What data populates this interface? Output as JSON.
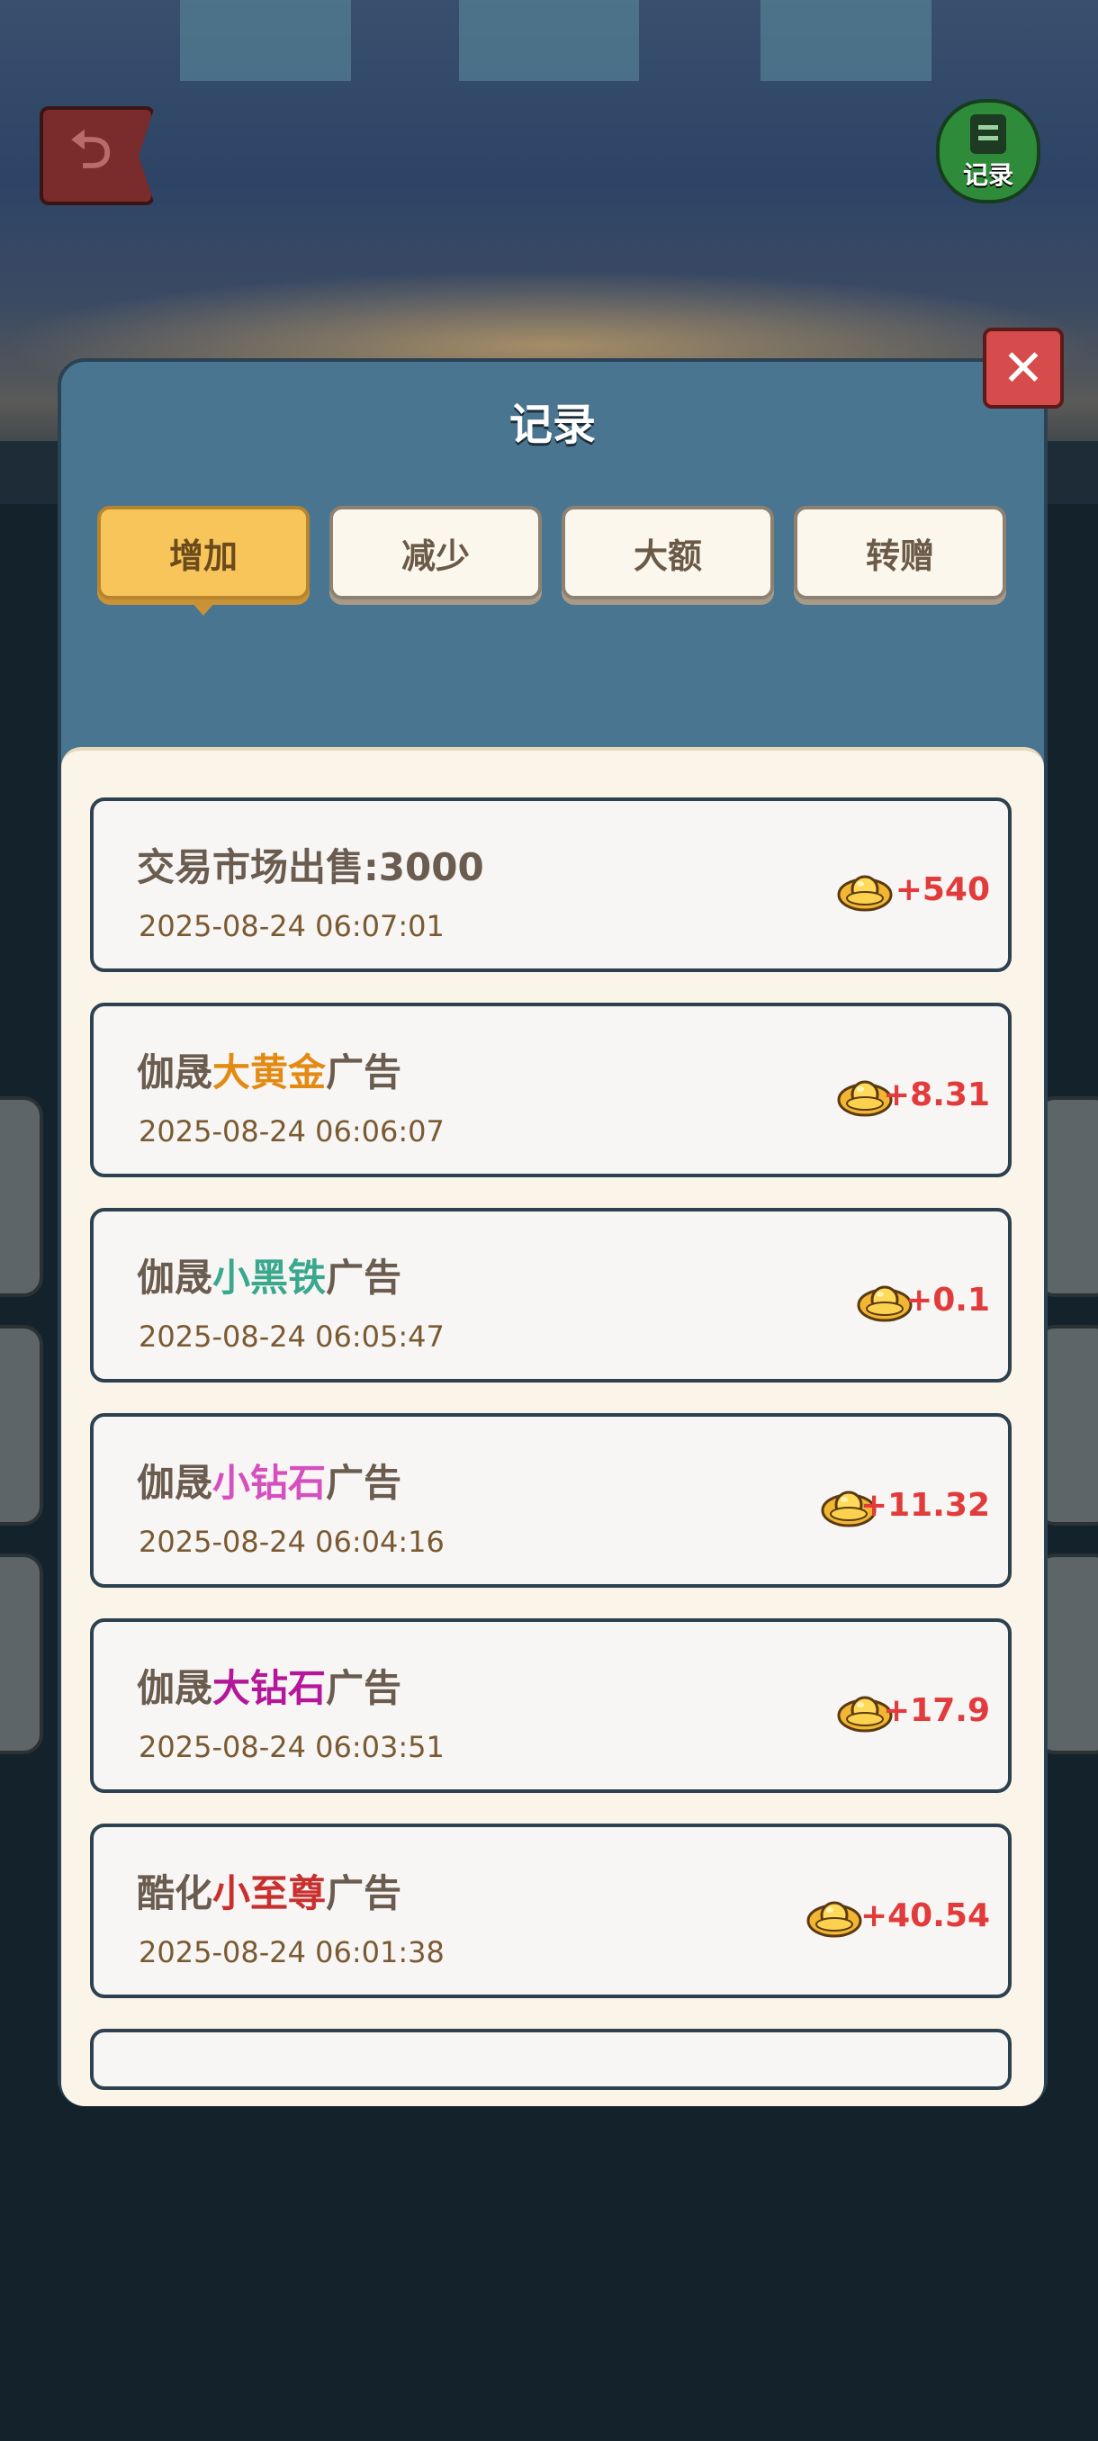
{
  "header": {
    "record_button_label": "记录"
  },
  "modal": {
    "title": "记录",
    "close_symbol": "✕",
    "tabs": [
      {
        "label": "增加",
        "active": true
      },
      {
        "label": "减少",
        "active": false
      },
      {
        "label": "大额",
        "active": false
      },
      {
        "label": "转赠",
        "active": false
      }
    ]
  },
  "records": [
    {
      "title_prefix": "交易市场出售:3000",
      "title_highlight": "",
      "title_suffix": "",
      "highlight_color": "#6b5c50",
      "time": "2025-08-24 06:07:01",
      "amount": "+540"
    },
    {
      "title_prefix": "伽晟",
      "title_highlight": "大黄金",
      "title_suffix": "广告",
      "highlight_color": "#e38a12",
      "time": "2025-08-24 06:06:07",
      "amount": "+8.31"
    },
    {
      "title_prefix": "伽晟",
      "title_highlight": "小黑铁",
      "title_suffix": "广告",
      "highlight_color": "#3aa88d",
      "time": "2025-08-24 06:05:47",
      "amount": "+0.1"
    },
    {
      "title_prefix": "伽晟",
      "title_highlight": "小钻石",
      "title_suffix": "广告",
      "highlight_color": "#d64fbf",
      "time": "2025-08-24 06:04:16",
      "amount": "+11.32"
    },
    {
      "title_prefix": "伽晟",
      "title_highlight": "大钻石",
      "title_suffix": "广告",
      "highlight_color": "#b5169b",
      "time": "2025-08-24 06:03:51",
      "amount": "+17.9"
    },
    {
      "title_prefix": "酷化",
      "title_highlight": "小至尊",
      "title_suffix": "广告",
      "highlight_color": "#c8302e",
      "time": "2025-08-24 06:01:38",
      "amount": "+40.54"
    }
  ],
  "icons": {
    "back": "back-arrow-icon",
    "record": "record-icon",
    "close": "close-icon",
    "currency": "gold-ingot-icon"
  },
  "colors": {
    "amount": "#e23b3b",
    "tab_active": "#f7c55a",
    "modal": "#4a7590"
  }
}
